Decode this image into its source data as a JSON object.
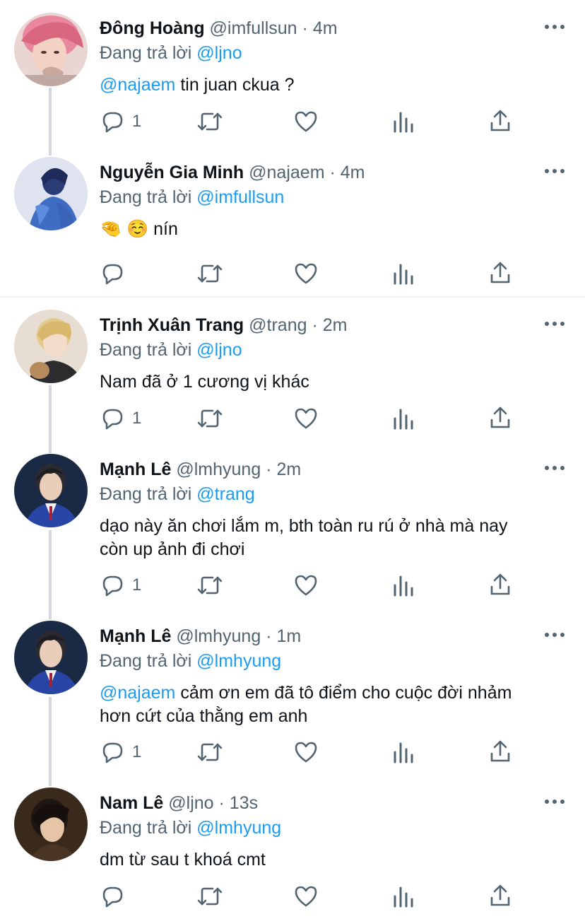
{
  "colors": {
    "link": "#1d9bf0",
    "muted": "#536471",
    "text": "#0f1419",
    "thread": "#cfd9de"
  },
  "icons": {
    "reply": "speech-bubble-icon",
    "retweet": "retweet-icon",
    "like": "heart-icon",
    "views": "bar-chart-icon",
    "share": "share-icon",
    "more": "three-dots-icon"
  },
  "tweets": [
    {
      "name": "Đông Hoàng",
      "handle": "@imfullsun",
      "dot": "·",
      "time": "4m",
      "replying_label": "Đang trả lời",
      "replying_to": "@ljno",
      "mention": "@najaem",
      "text": " tin juan ckua ?",
      "text2": "",
      "replies": "1"
    },
    {
      "name": "Nguyễn Gia Minh",
      "handle": "@najaem",
      "dot": "·",
      "time": "4m",
      "replying_label": "Đang trả lời",
      "replying_to": "@imfullsun",
      "mention": "",
      "text": "🤏 ☺️ nín",
      "text2": "",
      "replies": ""
    },
    {
      "name": "Trịnh Xuân Trang",
      "handle": "@trang",
      "dot": "·",
      "time": "2m",
      "replying_label": "Đang trả lời",
      "replying_to": "@ljno",
      "mention": "",
      "text": "Nam đã ở 1 cương vị khác",
      "text2": "",
      "replies": "1"
    },
    {
      "name": "Mạnh Lê",
      "handle": "@lmhyung",
      "dot": "·",
      "time": "2m",
      "replying_label": "Đang trả lời",
      "replying_to": "@trang",
      "mention": "",
      "text": "dạo này ăn chơi lắm m, bth toàn ru rú ở nhà mà nay",
      "text2": "còn up ảnh đi chơi",
      "replies": "1"
    },
    {
      "name": "Mạnh Lê",
      "handle": "@lmhyung",
      "dot": "·",
      "time": "1m",
      "replying_label": "Đang trả lời",
      "replying_to": "@lmhyung",
      "mention": "@najaem",
      "text": " cảm ơn em đã tô điểm cho cuộc đời nhảm",
      "text2": "hơn cứt của thằng em anh",
      "replies": "1"
    },
    {
      "name": "Nam Lê",
      "handle": "@ljno",
      "dot": "·",
      "time": "13s",
      "replying_label": "Đang trả lời",
      "replying_to": "@lmhyung",
      "mention": "",
      "text": "dm từ sau t khoá cmt",
      "text2": "",
      "replies": ""
    }
  ]
}
